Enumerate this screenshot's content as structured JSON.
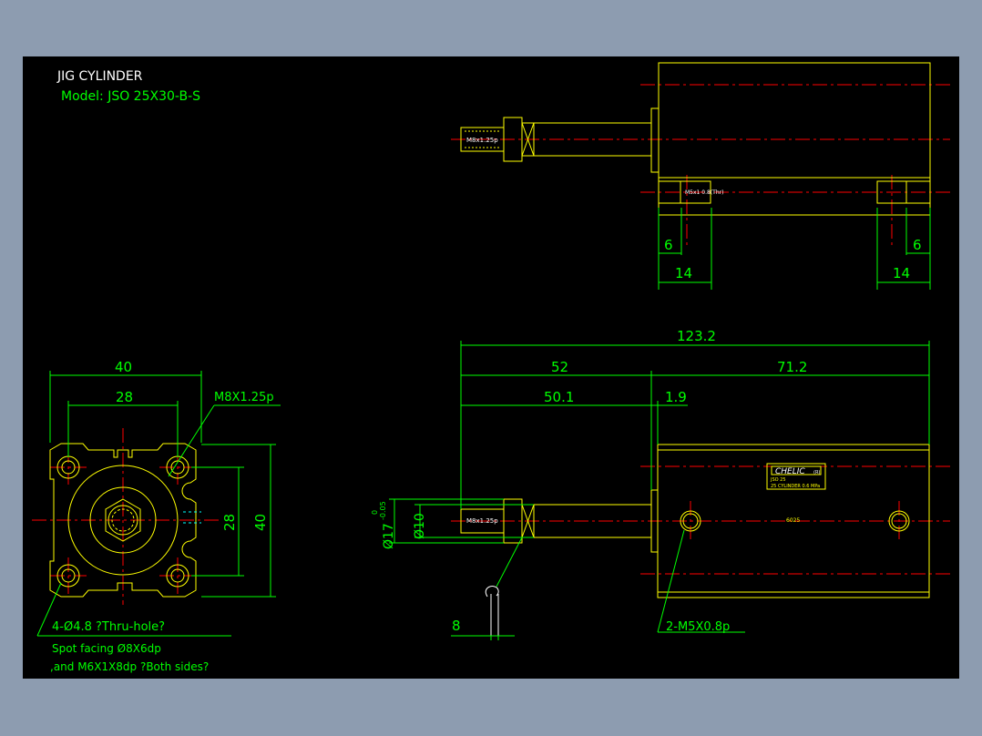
{
  "title_block": {
    "title": "JIG CYLINDER",
    "model": "Model:  JSO 25X30-B-S"
  },
  "colors": {
    "background": "#000000",
    "frame": "#8d9cb0",
    "part_outline": "#ffff00",
    "dimension": "#00ff00",
    "centerline": "#ff0000",
    "white_text": "#ffffff",
    "hatch": "#00ffff"
  },
  "top_view": {
    "thread_label": "M8x1.25p",
    "port_label": "M5x1 0.8(Thr)",
    "dims": {
      "left_6": "6",
      "right_6": "6",
      "left_14": "14",
      "right_14": "14"
    }
  },
  "end_view": {
    "dims": {
      "width_40": "40",
      "pitch_28": "28",
      "height_28": "28",
      "height_40": "40"
    },
    "thread_callout": "M8X1.25p",
    "hole_note_line1": "4-Ø4.8 ?Thru-hole?",
    "hole_note_line2": "Spot facing  Ø8X6dp",
    "hole_note_line3": ",and M6X1X8dp ?Both sides?"
  },
  "side_view": {
    "dims": {
      "overall": "123.2",
      "d52": "52",
      "d71_2": "71.2",
      "d50_1": "50.1",
      "d1_9": "1.9",
      "rod_dia": "Ø10",
      "collar_dia": "Ø17",
      "collar_tol_upper": "0",
      "collar_tol_lower": "-0.05",
      "wrench_8": "8"
    },
    "thread_label": "M8x1.25p",
    "port_callout": "2-M5X0.8p",
    "brand": "CHELIC",
    "brand_mark": "(R)",
    "nameplate_line1": "JSO 25",
    "nameplate_line2": "25 CYLINDER  0.6 MPa",
    "nameplate_code": "6025"
  }
}
